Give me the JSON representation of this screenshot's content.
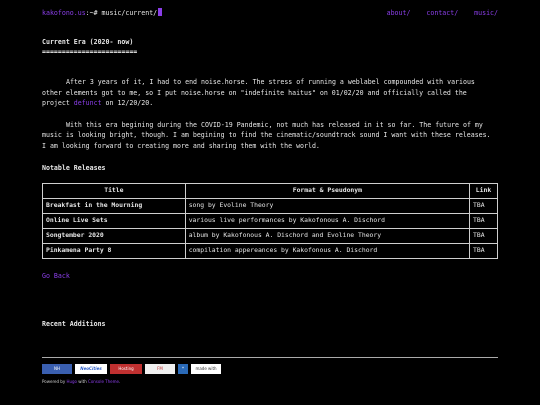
{
  "header": {
    "host": "kakofono.us",
    "path": ":~# music/current/",
    "nav": [
      "about/",
      "contact/",
      "music/"
    ]
  },
  "main": {
    "title": "Current Era (2020- now)",
    "underline": "========================",
    "para1_before": "After 3 years of it, I had to end noise.horse. The stress of running a weblabel compounded with various other elements got to me, so I put noise.horse on \"indefinite haitus\" on 01/02/20 and officially called the project ",
    "para1_link": "defunct",
    "para1_after": " on 12/20/20.",
    "para2": "With this era begining during the COVID-19 Pandemic, not much has released in it so far. The future of my music is looking bright, though. I am begining to find the cinematic/soundtrack sound I want with these releases. I am looking forward to creating more and sharing them with the world.",
    "notable_heading": "Notable Releases",
    "table": {
      "headers": [
        "Title",
        "Format & Pseudonym",
        "Link"
      ],
      "rows": [
        [
          "Breakfast in the Mourning",
          "song by Evoline Theory",
          "TBA"
        ],
        [
          "Online Live Sets",
          "various live performances by Kakofonous A. Dischord",
          "TBA"
        ],
        [
          "Songtember 2020",
          "album by Kakofonous A. Dischord and Evoline Theory",
          "TBA"
        ],
        [
          "Pinkamena Party 8",
          "compilation appereances by Kakofonous A. Dischord",
          "TBA"
        ]
      ]
    },
    "go_back": "Go Back",
    "recent_heading": "Recent Additions"
  },
  "footer": {
    "badges": [
      {
        "label": "NH",
        "bg": "#3a5fb0",
        "fg": "#ffffff"
      },
      {
        "label": "NeoCities",
        "bg": "#ffffff",
        "fg": "#2a5cc8"
      },
      {
        "label": "Hosting",
        "bg": "#c03030",
        "fg": "#ffffff"
      },
      {
        "label": "FM",
        "bg": "#f0f0f0",
        "fg": "#c03030"
      },
      {
        "label": "*",
        "bg": "#2a6ab8",
        "fg": "#ffffff"
      },
      {
        "label": "made with",
        "bg": "#ffffff",
        "fg": "#333333"
      }
    ],
    "powered_prefix": "Powered by ",
    "powered_link1": "Hugo",
    "powered_mid": " with ",
    "powered_link2": "Console Theme",
    "powered_suffix": "."
  }
}
